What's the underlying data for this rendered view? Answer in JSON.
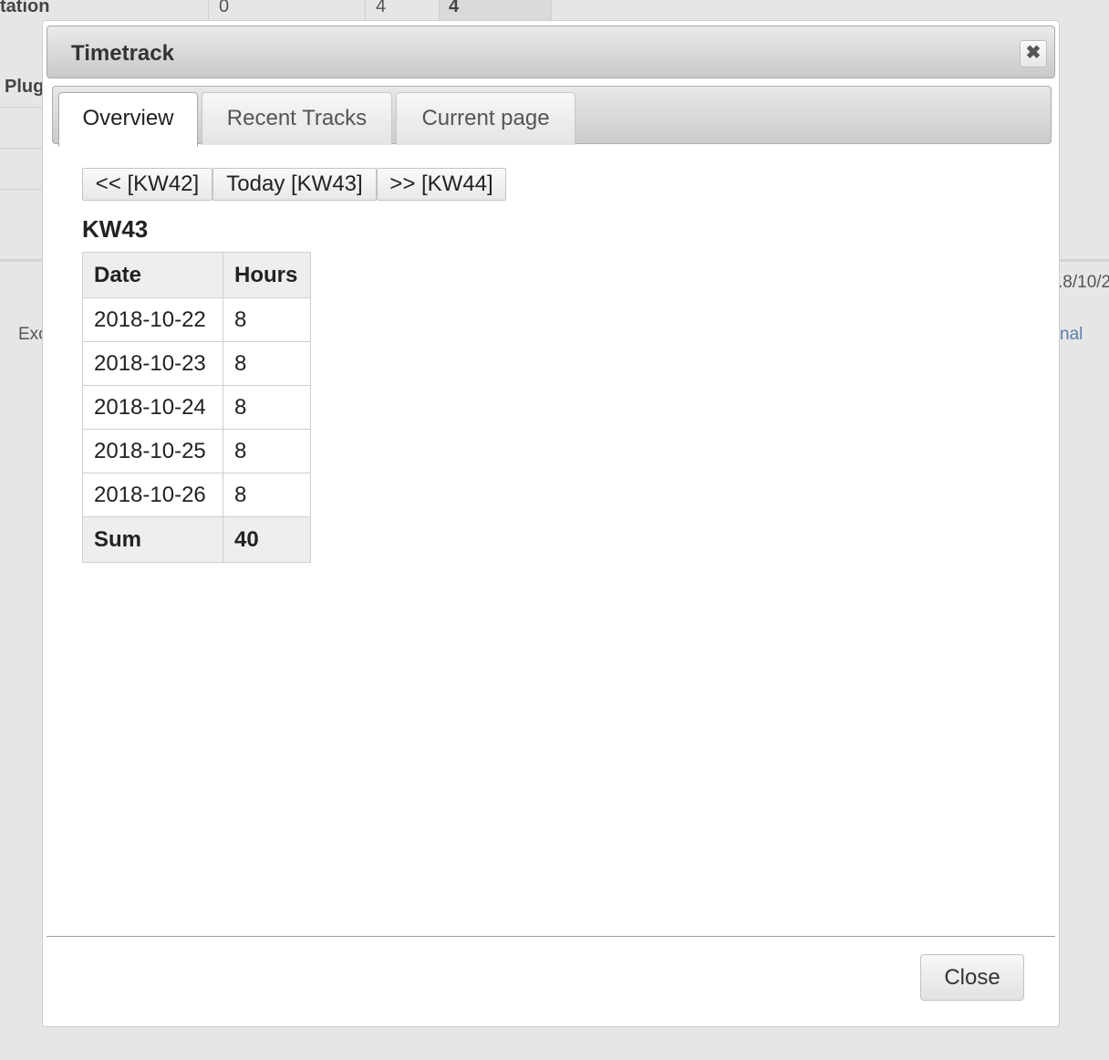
{
  "background": {
    "row_label_1": "tation",
    "col_value_1": "0",
    "col_value_2": "4",
    "col_value_3": "4",
    "row_label_2": "Plug",
    "left_text": "Exc",
    "right_date": ".8/10/2",
    "right_link": "nal"
  },
  "dialog": {
    "title": "Timetrack",
    "close_icon": "close-icon",
    "tabs": [
      {
        "label": "Overview",
        "active": true
      },
      {
        "label": "Recent Tracks",
        "active": false
      },
      {
        "label": "Current page",
        "active": false
      }
    ],
    "nav": {
      "prev_label": "<< [KW42]",
      "today_label": "Today [KW43]",
      "next_label": ">> [KW44]"
    },
    "week_heading": "KW43",
    "table": {
      "headers": [
        "Date",
        "Hours"
      ],
      "rows": [
        [
          "2018-10-22",
          "8"
        ],
        [
          "2018-10-23",
          "8"
        ],
        [
          "2018-10-24",
          "8"
        ],
        [
          "2018-10-25",
          "8"
        ],
        [
          "2018-10-26",
          "8"
        ]
      ],
      "sum_label": "Sum",
      "sum_value": "40"
    },
    "close_button_label": "Close"
  }
}
